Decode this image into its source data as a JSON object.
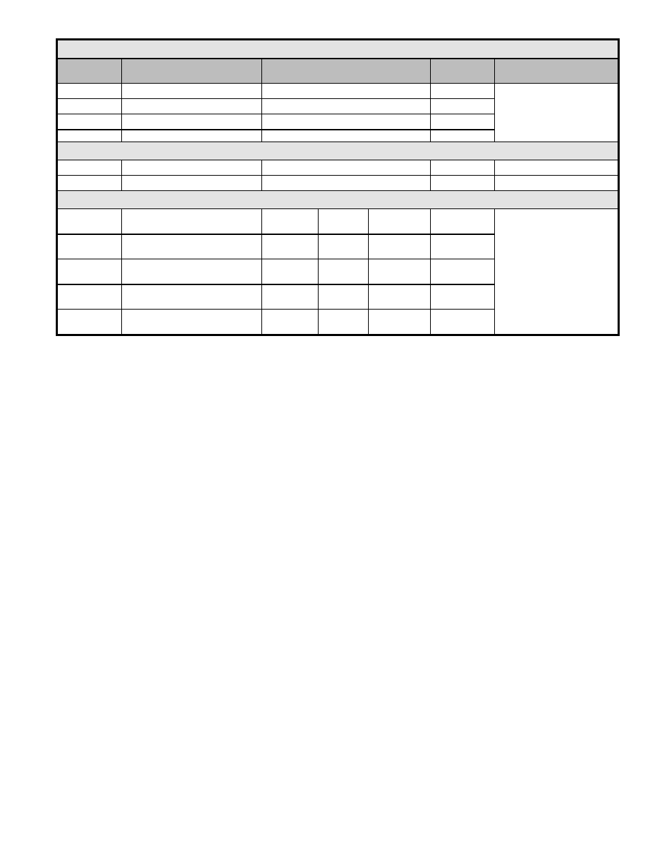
{
  "table": {
    "title": "",
    "headers": [
      "",
      "",
      "",
      "",
      ""
    ],
    "section1_rows": [
      [
        "",
        "",
        "",
        "",
        ""
      ],
      [
        "",
        "",
        "",
        "",
        ""
      ],
      [
        "",
        "",
        "",
        "",
        ""
      ],
      [
        "",
        "",
        "",
        "",
        ""
      ]
    ],
    "section2_title": "",
    "section2_rows": [
      [
        "",
        "",
        "",
        "",
        ""
      ],
      [
        "",
        "",
        "",
        "",
        ""
      ]
    ],
    "section3_title": "",
    "section3_rows": [
      [
        "",
        "",
        "",
        "",
        "",
        "",
        ""
      ],
      [
        "",
        "",
        "",
        "",
        "",
        "",
        ""
      ],
      [
        "",
        "",
        "",
        "",
        "",
        "",
        ""
      ],
      [
        "",
        "",
        "",
        "",
        "",
        "",
        ""
      ],
      [
        "",
        "",
        "",
        "",
        "",
        "",
        ""
      ]
    ]
  }
}
